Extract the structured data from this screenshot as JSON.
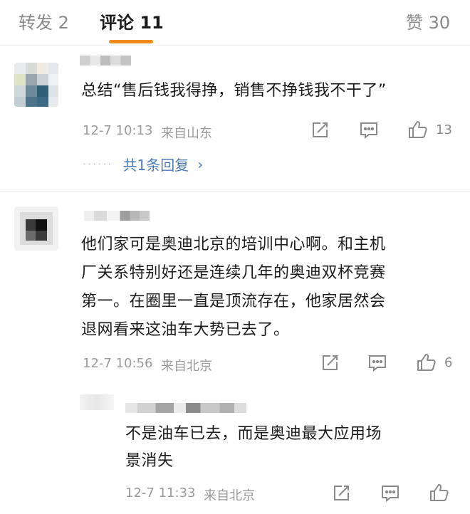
{
  "tabs": [
    {
      "label": "转发 2"
    },
    {
      "label": "评论 11"
    },
    {
      "label": "赞 30"
    }
  ],
  "comments": [
    {
      "text": "总结“售后钱我得挣，销售不挣钱我不干了”",
      "time": "12-7 10:13",
      "location": "来自山东",
      "likes": "13",
      "replies_link": "共1条回复",
      "avatar_icon": "blurred-avatar"
    },
    {
      "text_lines": [
        "他们家可是奥迪北京的培训中心啊。和主机",
        "厂关系特别好还是连续几年的奥迪双杯竞赛",
        "第一。在圈里一直是顶流存在，他家居然会",
        "退网看来这油车大势已去了。"
      ],
      "time": "12-7 10:56",
      "location": "来自北京",
      "likes": "6",
      "avatar_icon": "blurred-avatar"
    }
  ],
  "reply": {
    "text_lines": [
      "不是油车已去，而是奥迪最大应用场",
      "景消失"
    ],
    "time": "12-7 11:33",
    "location": "来自北京"
  },
  "icons": {
    "share": "share-icon",
    "comment": "comment-icon",
    "like": "thumbs-up-icon",
    "chevron": "chevron-right-icon"
  },
  "colors": {
    "accent": "#f08a1c",
    "link": "#4a7bb7",
    "meta": "#9a9a9a"
  }
}
